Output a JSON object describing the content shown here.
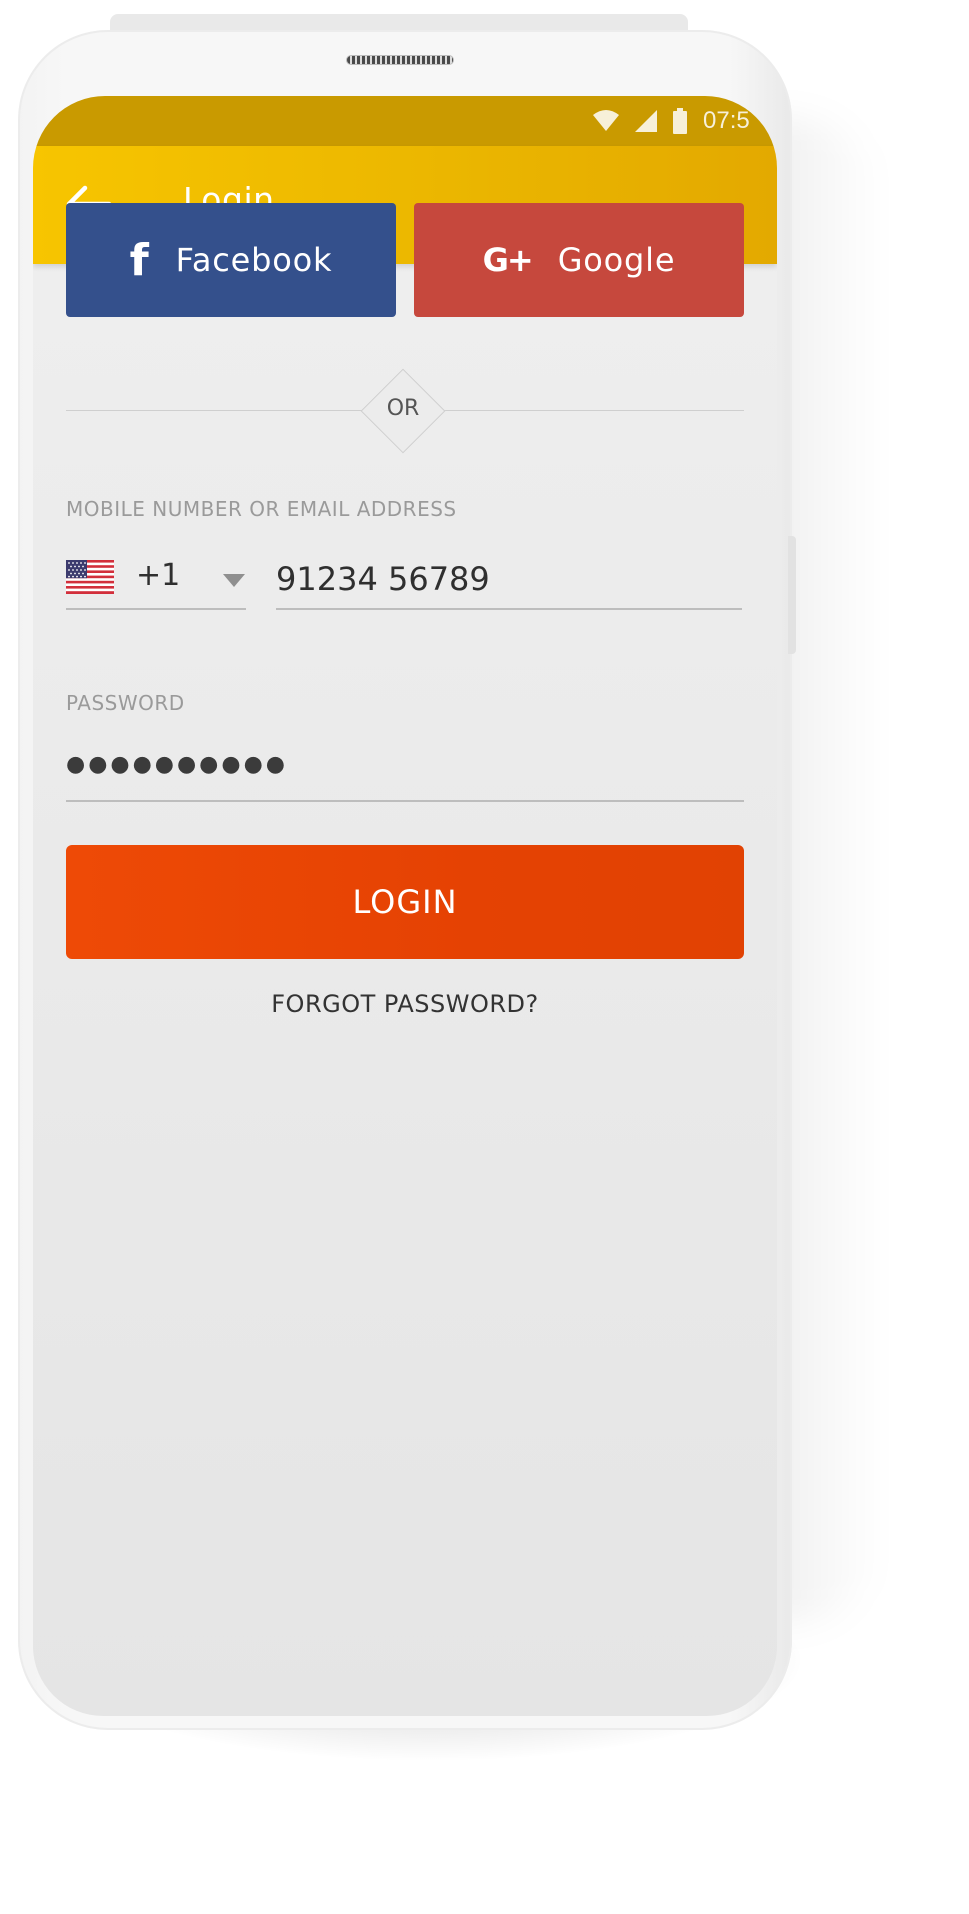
{
  "status_bar": {
    "time": "07:5",
    "icons": [
      "wifi-icon",
      "signal-icon",
      "battery-icon"
    ]
  },
  "app_bar": {
    "title": "Login",
    "back_icon": "back-arrow-icon"
  },
  "social": {
    "facebook_label": "Facebook",
    "facebook_icon": "f",
    "google_label": "Google",
    "google_icon": "G+"
  },
  "divider": {
    "or_text": "OR"
  },
  "form": {
    "mobile_label": "MOBILE NUMBER OR EMAIL ADDRESS",
    "country_flag": "us-flag-icon",
    "dial_code": "+1",
    "phone_value": "91234 56789",
    "password_label": "PASSWORD",
    "password_mask": "●●●●●●●●●●",
    "login_label": "LOGIN",
    "forgot_label": "FORGOT PASSWORD?"
  },
  "colors": {
    "app_bar": "#f0bd00",
    "status_bar": "#c99a00",
    "facebook": "#34508c",
    "google": "#c6483d",
    "login": "#e84503"
  }
}
